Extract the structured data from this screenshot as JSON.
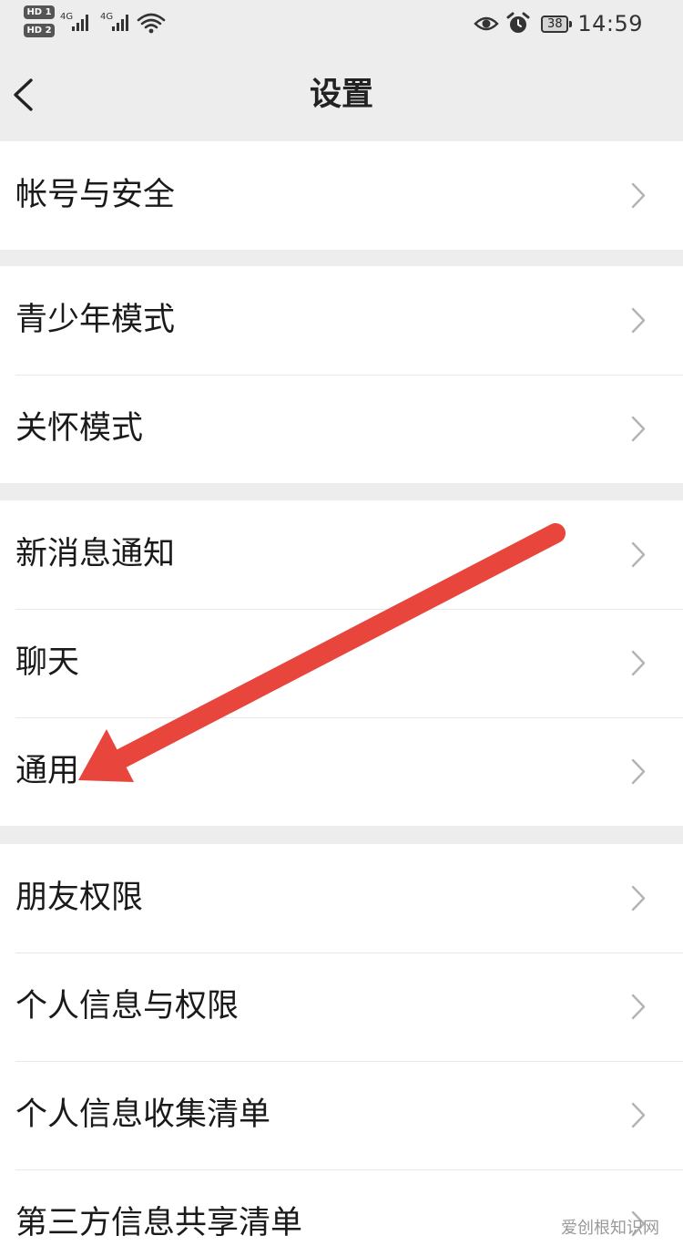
{
  "status_bar": {
    "sim1_badge": "HD 1",
    "sim2_badge": "HD 2",
    "network1": "4G",
    "network2": "4G",
    "battery": "38",
    "time": "14:59"
  },
  "nav": {
    "title": "设置"
  },
  "groups": [
    {
      "items": [
        {
          "label": "帐号与安全"
        }
      ]
    },
    {
      "items": [
        {
          "label": "青少年模式"
        },
        {
          "label": "关怀模式"
        }
      ]
    },
    {
      "items": [
        {
          "label": "新消息通知"
        },
        {
          "label": "聊天"
        },
        {
          "label": "通用"
        }
      ]
    },
    {
      "items": [
        {
          "label": "朋友权限"
        },
        {
          "label": "个人信息与权限"
        },
        {
          "label": "个人信息收集清单"
        },
        {
          "label": "第三方信息共享清单"
        }
      ]
    }
  ],
  "annotation": {
    "arrow_color": "#e8453c",
    "points_to": "通用"
  },
  "watermark": "爱创根知识网"
}
